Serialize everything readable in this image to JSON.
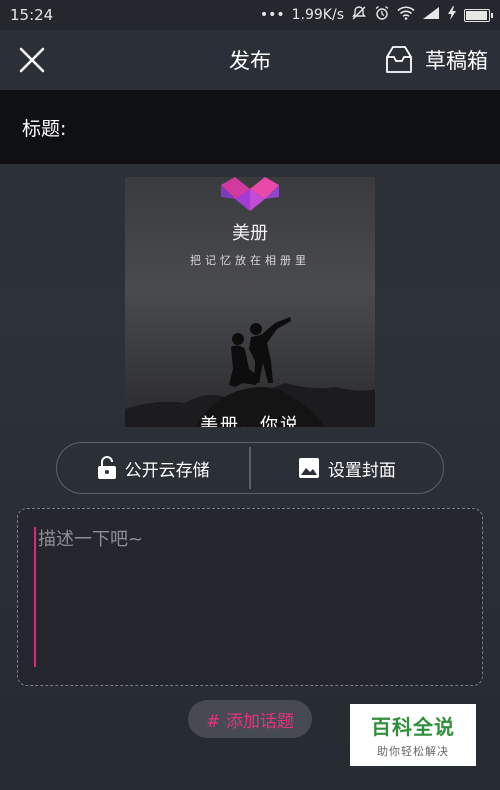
{
  "status_bar": {
    "time": "15:24",
    "dots": "•••",
    "network_speed": "1.99K/s",
    "icons": [
      "silent-icon",
      "alarm-icon",
      "wifi-icon",
      "signal-icon",
      "charging-icon",
      "battery-icon"
    ]
  },
  "header": {
    "close_icon": "close-icon",
    "title": "发布",
    "drafts_icon": "drafts-tray-icon",
    "drafts_label": "草稿箱"
  },
  "title_field": {
    "label": "标题:",
    "value": "",
    "placeholder": ""
  },
  "cover": {
    "app_name": "美册",
    "slogan": "把记忆放在相册里",
    "caption": "美册，你说"
  },
  "actions": {
    "storage_icon": "lock-icon",
    "storage_label": "公开云存储",
    "cover_icon": "image-icon",
    "cover_label": "设置封面"
  },
  "description": {
    "placeholder": "描述一下吧~",
    "value": ""
  },
  "topic_button": {
    "label": "# 添加话题"
  },
  "watermark": {
    "title": "百科全说",
    "subtitle": "助你轻松解决"
  },
  "colors": {
    "accent": "#e8317e",
    "background": "#2b2f37",
    "title_bar": "#0f1013",
    "watermark_green": "#2f8f3a"
  }
}
